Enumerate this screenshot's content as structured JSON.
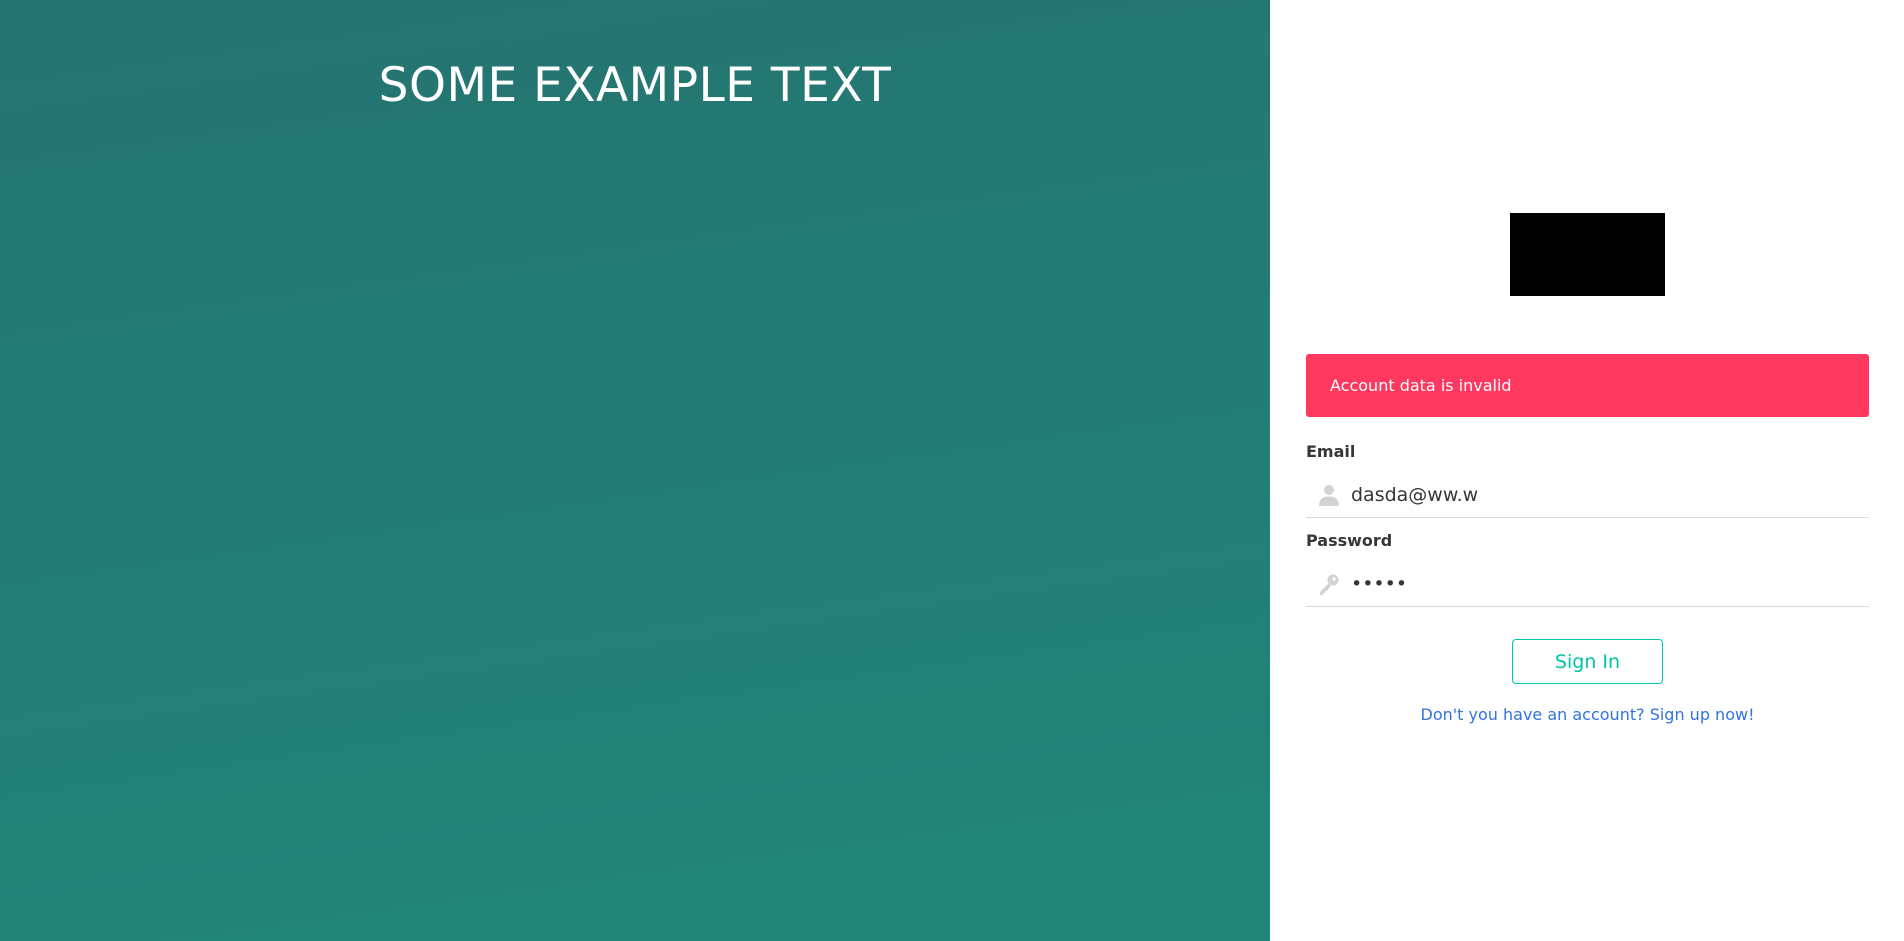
{
  "hero": {
    "title": "SOME EXAMPLE TEXT"
  },
  "alert": {
    "message": "Account data is invalid"
  },
  "form": {
    "email_label": "Email",
    "email_value": "dasda@ww.w",
    "email_icon": "user-icon",
    "password_label": "Password",
    "password_value": "•••••",
    "password_icon": "key-icon",
    "signin_label": "Sign In",
    "signup_text": "Don't you have an account? Sign up now!"
  },
  "colors": {
    "hero_bg": "#237c75",
    "alert_bg": "#ff3860",
    "primary": "#00c4a7",
    "link": "#3273dc"
  }
}
